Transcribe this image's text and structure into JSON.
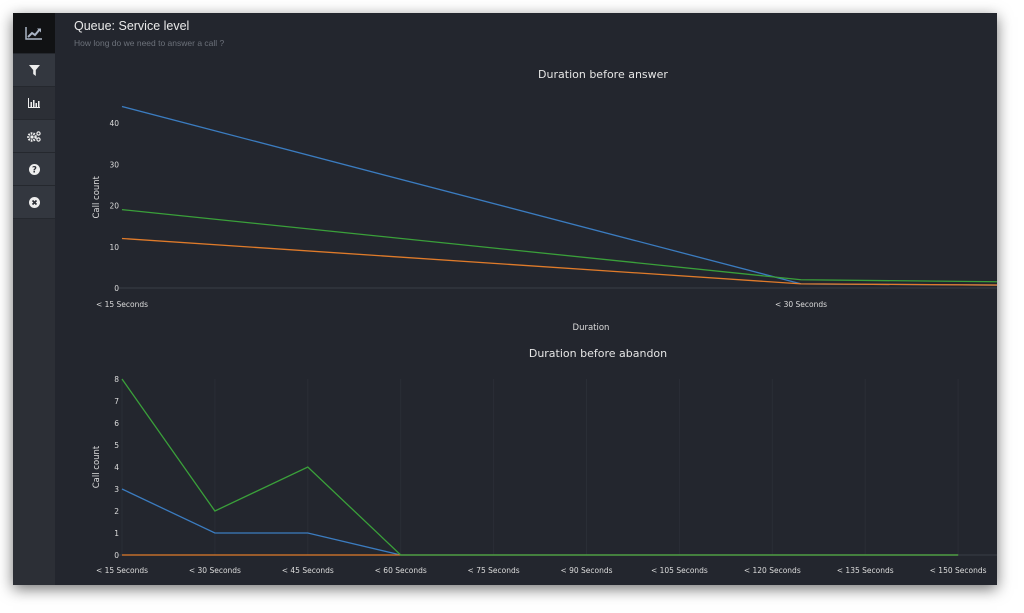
{
  "header": {
    "title": "Queue: Service level",
    "subtitle": "How long do we need to answer a call ?"
  },
  "sidebar": {
    "items": [
      {
        "icon": "line-chart-icon",
        "active": true
      },
      {
        "icon": "filter-icon"
      },
      {
        "icon": "bar-chart-icon"
      },
      {
        "icon": "gears-icon"
      },
      {
        "icon": "question-circle-icon"
      },
      {
        "icon": "close-circle-icon"
      }
    ]
  },
  "colors": {
    "blue": "#3b7cc0",
    "green": "#3aa03a",
    "orange": "#e07b2a",
    "background": "#23262e"
  },
  "chart_data": [
    {
      "type": "line",
      "title": "Duration before answer",
      "xlabel": "Duration",
      "ylabel": "Call count",
      "categories": [
        "< 15 Seconds",
        "< 30 Seconds"
      ],
      "x_visible_range": [
        0,
        1.29
      ],
      "ylim": [
        0,
        44
      ],
      "yticks": [
        0,
        10,
        20,
        30,
        40
      ],
      "grid": false,
      "series": [
        {
          "color": "#3b7cc0",
          "values": [
            44,
            1,
            0
          ]
        },
        {
          "color": "#3aa03a",
          "values": [
            19,
            2,
            0.3
          ]
        },
        {
          "color": "#e07b2a",
          "values": [
            12,
            1,
            0
          ]
        }
      ]
    },
    {
      "type": "line",
      "title": "Duration before abandon",
      "xlabel": "",
      "ylabel": "Call count",
      "categories": [
        "< 15 Seconds",
        "< 30 Seconds",
        "< 45 Seconds",
        "< 60 Seconds",
        "< 75 Seconds",
        "< 90 Seconds",
        "< 105 Seconds",
        "< 120 Seconds",
        "< 135 Seconds",
        "< 150 Seconds"
      ],
      "ylim": [
        0,
        8
      ],
      "yticks": [
        0,
        1,
        2,
        3,
        4,
        5,
        6,
        7,
        8
      ],
      "grid": true,
      "series": [
        {
          "color": "#3b7cc0",
          "values": [
            3,
            1,
            1,
            0,
            0,
            0,
            0,
            0,
            0,
            0
          ]
        },
        {
          "color": "#e07b2a",
          "values": [
            0,
            0,
            0,
            0,
            0,
            0,
            0,
            0,
            0,
            0
          ]
        },
        {
          "color": "#3aa03a",
          "values": [
            8,
            2,
            4,
            0,
            0,
            0,
            0,
            0,
            0,
            0
          ]
        }
      ]
    }
  ]
}
